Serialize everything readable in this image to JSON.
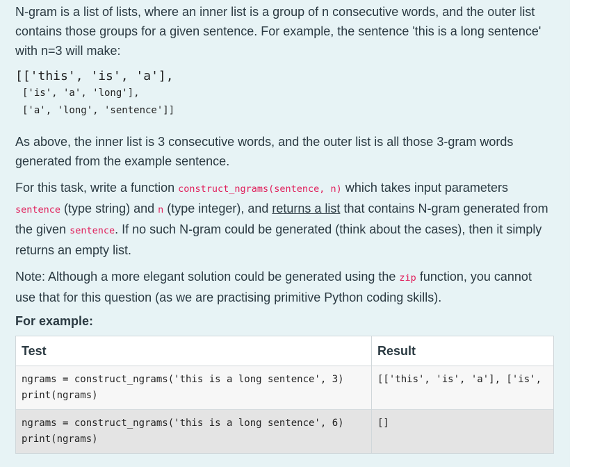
{
  "paragraphs": {
    "intro": "N-gram is a list of lists, where an inner list is a group of n consecutive words, and the outer list contains those groups for a given sentence. For example, the sentence 'this is a long sentence' with n=3 will make:",
    "above": "As above, the inner list is 3 consecutive words, and the outer list is all those 3-gram words generated from the example sentence.",
    "task_1": "For this task, write a function",
    "task_fn": "construct_ngrams(sentence, n)",
    "task_2": "which takes input parameters",
    "task_p1": "sentence",
    "task_3": "(type string) and",
    "task_p2": "n",
    "task_4": "(type integer), and",
    "task_link": "returns a list",
    "task_5": "that contains N-gram generated from the given",
    "task_p3": "sentence",
    "task_6": ". If no such N-gram could be generated (think about the cases), then it simply returns an empty list.",
    "note_1": "Note: Although a more elegant solution could be generated using the",
    "note_code": "zip",
    "note_2": "function, you cannot use that for this question (as we are practising primitive Python coding skills)."
  },
  "example_block": {
    "line1": "[['this', 'is', 'a'],",
    "line2": "['is', 'a', 'long'],",
    "line3": "['a', 'long', 'sentence']]"
  },
  "for_example_heading": "For example:",
  "table": {
    "headers": [
      "Test",
      "Result"
    ],
    "rows": [
      {
        "test": "ngrams = construct_ngrams('this is a long sentence', 3)\nprint(ngrams)",
        "result": "[['this', 'is', 'a'], ['is',"
      },
      {
        "test": "ngrams = construct_ngrams('this is a long sentence', 6)\nprint(ngrams)",
        "result": "[]"
      }
    ]
  }
}
